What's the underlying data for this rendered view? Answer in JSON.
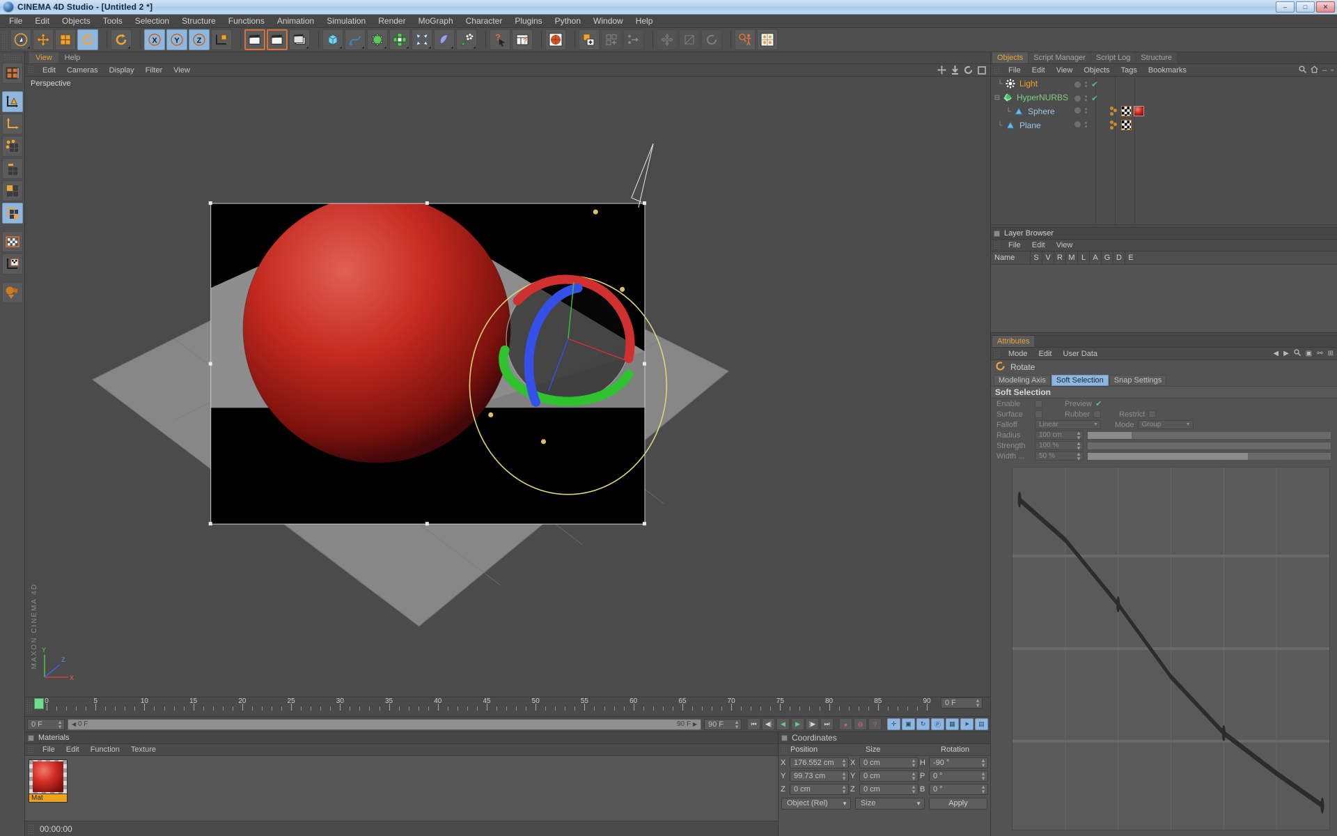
{
  "window": {
    "title": "CINEMA 4D Studio - [Untitled 2 *]",
    "minimize": "–",
    "maximize": "□",
    "close": "✕"
  },
  "menubar": {
    "items": [
      "File",
      "Edit",
      "Objects",
      "Tools",
      "Selection",
      "Structure",
      "Functions",
      "Animation",
      "Simulation",
      "Render",
      "MoGraph",
      "Character",
      "Plugins",
      "Python",
      "Window",
      "Help"
    ]
  },
  "toolbar": {
    "icons": [
      "undo-icon",
      "move-icon",
      "scale-icon",
      "rotate-icon",
      "rotate-alt-icon",
      "x-axis-icon",
      "y-axis-icon",
      "z-axis-icon",
      "world-object-axis-icon",
      "render-view-icon",
      "render-region-icon",
      "render-settings-icon",
      "cube-primitive-icon",
      "spline-pen-icon",
      "nurbs-icon",
      "array-icon",
      "deformer-icon",
      "scene-object-icon",
      "particle-icon",
      "help-cursor-icon",
      "content-browser-icon",
      "material-sphere-icon",
      "add-layer-icon",
      "add-point-icon",
      "transfer-icon",
      "move-tool-dim-icon",
      "scale-tool-dim-icon",
      "rotate-tool-dim-icon",
      "magnify-figure-icon",
      "texture-grid-icon"
    ]
  },
  "left_toolbar": {
    "icons": [
      "layout-grid-icon",
      "model-mode-icon",
      "axis-mode-icon",
      "points-mode-icon",
      "edges-mode-icon",
      "polygons-mode-icon",
      "object-axis-mode-icon",
      "texture-mode-icon",
      "texture-axis-mode-icon",
      "viewport-solo-icon"
    ]
  },
  "viewport": {
    "tabs": [
      {
        "label": "View",
        "active": true
      },
      {
        "label": "Help",
        "active": false
      }
    ],
    "menu": [
      "Edit",
      "Cameras",
      "Display",
      "Filter",
      "View"
    ],
    "corner_icons": [
      "pan-icon",
      "dolly-icon",
      "rotate-view-icon",
      "maximize-view-icon"
    ],
    "label": "Perspective",
    "watermark": "MAXON CINEMA 4D",
    "axis_labels": {
      "x": "X",
      "y": "Y",
      "z": "Z"
    }
  },
  "timeline": {
    "ticks": [
      0,
      5,
      10,
      15,
      20,
      25,
      30,
      35,
      40,
      45,
      50,
      55,
      60,
      65,
      70,
      75,
      80,
      85,
      90
    ],
    "max_frame": 90,
    "current_frame_field": "0 F",
    "frame_field_right": "0 F",
    "range_start": "0 F",
    "range_end": "90 F",
    "end_field": "90 F",
    "transport": [
      {
        "name": "go-to-start-button",
        "glyph": "⏮"
      },
      {
        "name": "step-back-button",
        "glyph": "◀|"
      },
      {
        "name": "play-back-button",
        "glyph": "◀"
      },
      {
        "name": "play-forward-button",
        "glyph": "▶"
      },
      {
        "name": "step-forward-button",
        "glyph": "|▶"
      },
      {
        "name": "go-to-end-button",
        "glyph": "⏭"
      }
    ],
    "record_buttons": [
      {
        "name": "record-keyframe-button",
        "glyph": "●"
      },
      {
        "name": "autokey-button",
        "glyph": "◍"
      },
      {
        "name": "keyframe-selection-button",
        "glyph": "?"
      }
    ],
    "key_toggles": [
      {
        "name": "key-position-button",
        "glyph": "✛",
        "active": true
      },
      {
        "name": "key-scale-button",
        "glyph": "▣",
        "active": true
      },
      {
        "name": "key-rotation-button",
        "glyph": "↻",
        "active": true
      },
      {
        "name": "key-parameter-button",
        "glyph": "Ⓟ",
        "active": true
      },
      {
        "name": "key-pla-button",
        "glyph": "▦",
        "active": true
      },
      {
        "name": "select-key-button",
        "glyph": "➤",
        "active": true
      },
      {
        "name": "layout-key-button",
        "glyph": "▤",
        "active": true
      }
    ]
  },
  "materials": {
    "panel_title": "Materials",
    "menu": [
      "File",
      "Edit",
      "Function",
      "Texture"
    ],
    "items": [
      {
        "name": "Mat"
      }
    ],
    "timecode": "00:00:00"
  },
  "coordinates": {
    "panel_title": "Coordinates",
    "columns": [
      "Position",
      "Size",
      "Rotation"
    ],
    "rows": [
      {
        "pos_label": "X",
        "pos_value": "176.552 cm",
        "size_label": "X",
        "size_value": "0 cm",
        "rot_label": "H",
        "rot_value": "-90 °"
      },
      {
        "pos_label": "Y",
        "pos_value": "99.73 cm",
        "size_label": "Y",
        "size_value": "0 cm",
        "rot_label": "P",
        "rot_value": "0 °"
      },
      {
        "pos_label": "Z",
        "pos_value": "0 cm",
        "size_label": "Z",
        "size_value": "0 cm",
        "rot_label": "B",
        "rot_value": "0 °"
      }
    ],
    "mode_select": "Object (Rel)",
    "size_select": "Size",
    "apply_label": "Apply"
  },
  "object_manager": {
    "tabs": [
      {
        "label": "Objects",
        "active": true
      },
      {
        "label": "Script Manager",
        "active": false
      },
      {
        "label": "Script Log",
        "active": false
      },
      {
        "label": "Structure",
        "active": false
      }
    ],
    "menu": [
      "File",
      "Edit",
      "View",
      "Objects",
      "Tags",
      "Bookmarks"
    ],
    "header_icons": [
      "search-icon",
      "home-icon",
      "minimize-icon",
      "close-icon"
    ],
    "items": [
      {
        "name": "Light",
        "icon": "light-icon",
        "depth": 0,
        "color": "orange",
        "expander": "",
        "visible_check": true,
        "tags": []
      },
      {
        "name": "HyperNURBS",
        "icon": "hypernurbs-icon",
        "depth": 0,
        "color": "green",
        "expander": "minus",
        "visible_check": true,
        "tags": []
      },
      {
        "name": "Sphere",
        "icon": "polygon-object-icon",
        "depth": 1,
        "color": "blue",
        "expander": "",
        "visible_check": false,
        "tags": [
          "phong-tag",
          "texture-tag",
          "material-tag"
        ]
      },
      {
        "name": "Plane",
        "icon": "polygon-object-icon",
        "depth": 0,
        "color": "blue",
        "expander": "",
        "visible_check": false,
        "tags": [
          "phong-tag",
          "texture-tag"
        ]
      }
    ]
  },
  "layer_browser": {
    "panel_title": "Layer Browser",
    "menu": [
      "File",
      "Edit",
      "View"
    ],
    "columns": [
      "Name",
      "S",
      "V",
      "R",
      "M",
      "L",
      "A",
      "G",
      "D",
      "E"
    ]
  },
  "attributes": {
    "tab": "Attributes",
    "menu": [
      "Mode",
      "Edit",
      "User Data"
    ],
    "header_icons": [
      "back-arrow-icon",
      "forward-arrow-icon",
      "search-icon",
      "lock-icon",
      "link-icon",
      "pin-icon"
    ],
    "tool_title": "Rotate",
    "tool_icon": "rotate-icon",
    "mode_tabs": [
      {
        "label": "Modeling Axis",
        "active": false
      },
      {
        "label": "Soft Selection",
        "active": true
      },
      {
        "label": "Snap Settings",
        "active": false
      }
    ],
    "section_title": "Soft Selection",
    "fields": {
      "enable_label": "Enable",
      "enable_checked": false,
      "preview_label": "Preview",
      "preview_checked": true,
      "surface_label": "Surface",
      "surface_checked": false,
      "rubber_label": "Rubber",
      "rubber_checked": false,
      "restrict_label": "Restrict",
      "restrict_checked": false,
      "falloff_label": "Falloff",
      "falloff_value": "Linear",
      "mode_label": "Mode",
      "mode_value": "Group",
      "radius_label": "Radius",
      "radius_value": "100 cm",
      "radius_pct": 18,
      "strength_label": "Strength",
      "strength_value": "100 %",
      "strength_pct": 0,
      "width_label": "Width ...",
      "width_value": "50 %",
      "width_pct": 66
    }
  },
  "colors": {
    "accent_orange": "#f0a41e",
    "selection_blue": "#8fb7dd",
    "panel_bg": "#535353",
    "viewport_bg": "#4b4b4b",
    "sphere_red": "#c02018",
    "axis_x_red": "#d03030",
    "axis_y_green": "#30c030",
    "axis_z_blue": "#3050e0",
    "rotate_band_yellow": "#e8e070"
  }
}
